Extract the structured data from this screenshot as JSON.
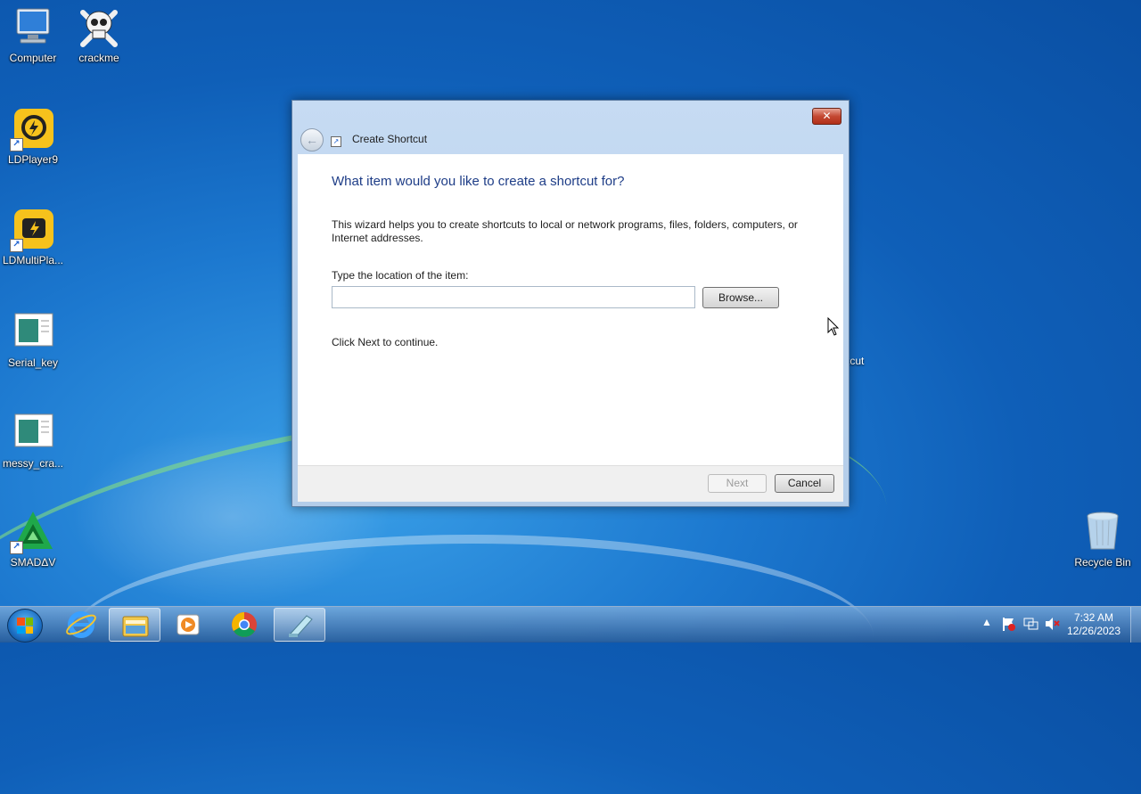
{
  "desktop": {
    "icons": [
      {
        "label": "Computer",
        "icon": "computer-icon"
      },
      {
        "label": "crackme",
        "icon": "skull-icon"
      },
      {
        "label": "LDPlayer9",
        "icon": "ldplayer-icon"
      },
      {
        "label": "LDMultiPla...",
        "icon": "ldmultiplayer-icon"
      },
      {
        "label": "Serial_key",
        "icon": "document-icon"
      },
      {
        "label": "messy_cra...",
        "icon": "document-icon"
      },
      {
        "label": "SMADΔV",
        "icon": "smadav-icon"
      },
      {
        "label": "Recycle Bin",
        "icon": "recycle-bin-icon"
      }
    ],
    "partial_label": "tcut"
  },
  "dialog": {
    "title": "Create Shortcut",
    "close_label": "✕",
    "heading": "What item would you like to create a shortcut for?",
    "description": "This wizard helps you to create shortcuts to local or network programs, files, folders, computers, or Internet addresses.",
    "location_label": "Type the location of the item:",
    "location_value": "",
    "browse_label": "Browse...",
    "continue_text": "Click Next to continue.",
    "next_label": "Next",
    "cancel_label": "Cancel"
  },
  "taskbar": {
    "pinned": [
      "internet-explorer-icon",
      "file-explorer-icon",
      "media-player-icon",
      "chrome-icon",
      "wizard-icon"
    ],
    "tray_chevron": "▲",
    "time": "7:32 AM",
    "date": "12/26/2023"
  },
  "colors": {
    "heading": "#1e3d87",
    "desktop_blue": "#1c78cf"
  }
}
